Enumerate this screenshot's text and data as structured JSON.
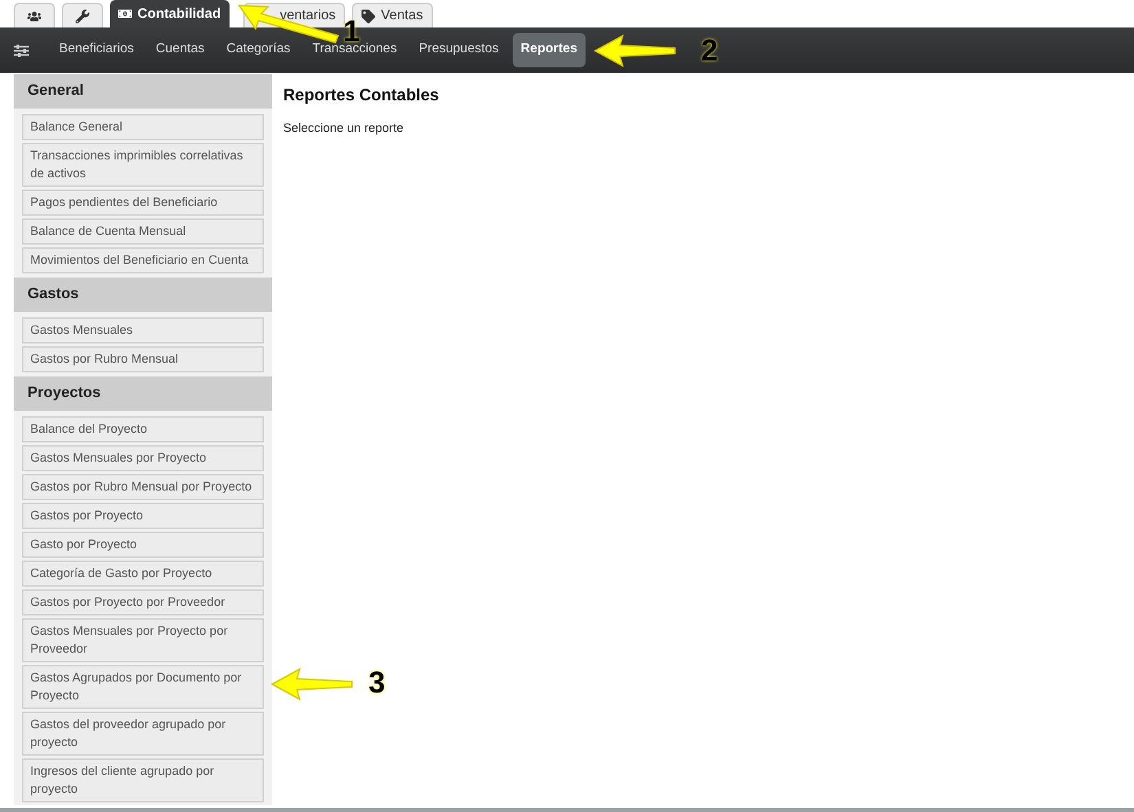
{
  "top_tabs": [
    {
      "kind": "icon",
      "selected": false
    },
    {
      "kind": "icon",
      "selected": false
    },
    {
      "kind": "text",
      "label": "Contabilidad",
      "selected": true
    },
    {
      "kind": "text",
      "label": "ventarios",
      "selected": false
    },
    {
      "kind": "text",
      "label": "Ventas",
      "selected": false
    }
  ],
  "nav": {
    "items": [
      {
        "label": "Beneficiarios",
        "selected": false
      },
      {
        "label": "Cuentas",
        "selected": false
      },
      {
        "label": "Categorías",
        "selected": false
      },
      {
        "label": "Transacciones",
        "selected": false
      },
      {
        "label": "Presupuestos",
        "selected": false
      },
      {
        "label": "Reportes",
        "selected": true
      }
    ]
  },
  "sidebar": {
    "sections": [
      {
        "title": "General",
        "items": [
          "Balance General",
          "Transacciones imprimibles correlativas de activos",
          "Pagos pendientes del Beneficiario",
          "Balance de Cuenta Mensual",
          "Movimientos del Beneficiario en Cuenta"
        ]
      },
      {
        "title": "Gastos",
        "items": [
          "Gastos Mensuales",
          "Gastos por Rubro Mensual"
        ]
      },
      {
        "title": "Proyectos",
        "items": [
          "Balance del Proyecto",
          "Gastos Mensuales por Proyecto",
          "Gastos por Rubro Mensual por Proyecto",
          "Gastos por Proyecto",
          "Gasto por Proyecto",
          "Categoría de Gasto por Proyecto",
          "Gastos por Proyecto por Proveedor",
          "Gastos Mensuales por Proyecto por Proveedor",
          "Gastos Agrupados por Documento por Proyecto",
          "Gastos del proveedor agrupado por proyecto",
          "Ingresos del cliente agrupado por proyecto"
        ]
      }
    ]
  },
  "content": {
    "title": "Reportes Contables",
    "text": "Seleccione un reporte"
  },
  "callouts": [
    "1",
    "2",
    "3"
  ]
}
